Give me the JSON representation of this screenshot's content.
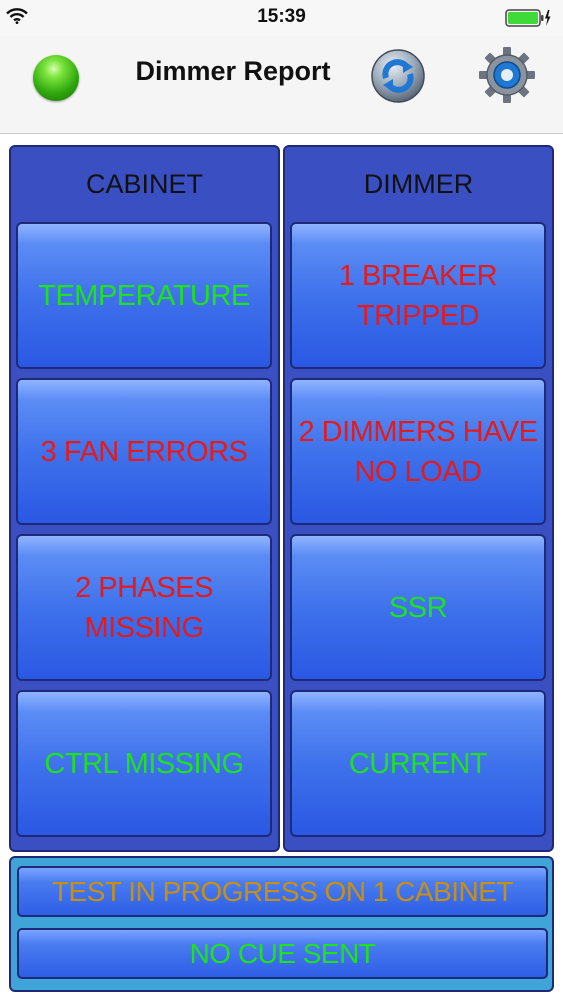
{
  "status_bar": {
    "time": "15:39"
  },
  "nav": {
    "title": "Dimmer Report",
    "status_color": "#2fa80d"
  },
  "cabinet": {
    "header": "CABINET",
    "tiles": [
      {
        "lines": [
          "TEMPERATURE"
        ],
        "state": "ok"
      },
      {
        "lines": [
          "3 FAN ERRORS"
        ],
        "state": "error"
      },
      {
        "lines": [
          "2 PHASES",
          "MISSING"
        ],
        "state": "error"
      },
      {
        "lines": [
          "CTRL MISSING"
        ],
        "state": "ok"
      }
    ]
  },
  "dimmer": {
    "header": "DIMMER",
    "tiles": [
      {
        "lines": [
          "1 BREAKER",
          "TRIPPED"
        ],
        "state": "error"
      },
      {
        "lines": [
          "2 DIMMERS HAVE",
          "NO LOAD"
        ],
        "state": "error"
      },
      {
        "lines": [
          "SSR"
        ],
        "state": "ok"
      },
      {
        "lines": [
          "CURRENT"
        ],
        "state": "ok"
      }
    ]
  },
  "status": {
    "test_progress": "TEST IN PROGRESS ON 1 CABINET",
    "cue": "NO CUE SENT"
  },
  "colors": {
    "ok": "#1fe21f",
    "error": "#e41b1b",
    "warning": "#c79012",
    "panel": "#3a4fc2"
  }
}
